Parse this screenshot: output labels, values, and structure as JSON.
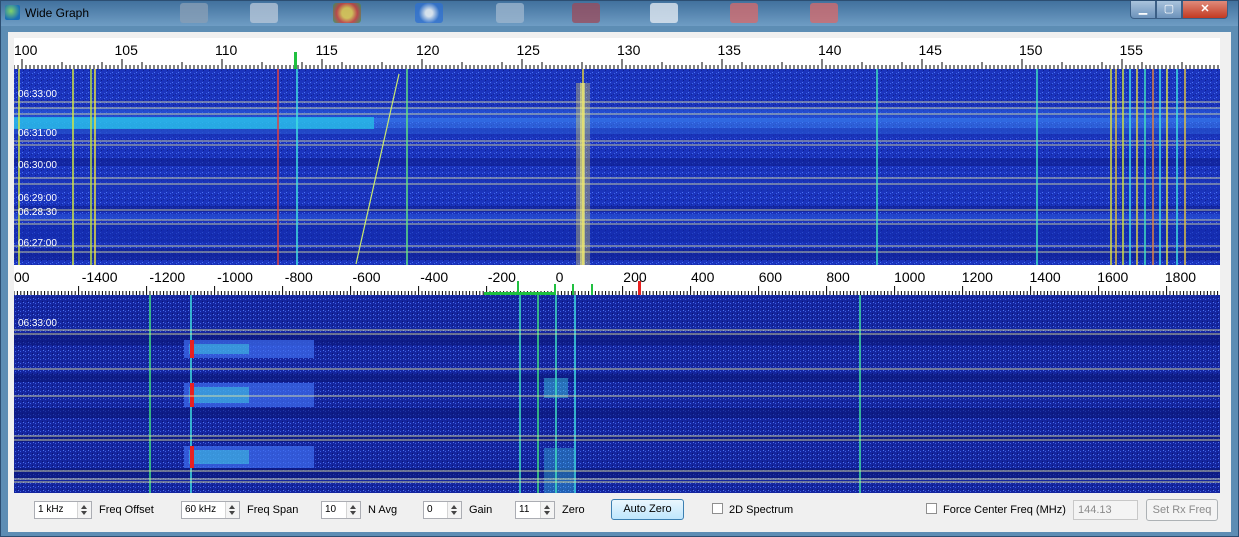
{
  "window": {
    "title": "Wide Graph",
    "min_symbol": "▁",
    "max_symbol": "▢",
    "close_symbol": "✕"
  },
  "colors": {
    "waterfall_bg": "#1a2fb4",
    "waterfall_dark": "#0c1c8a",
    "scale_bg": "#ffffff",
    "timestamp_line": "#e8e8a0",
    "signal_green": "#2ee84a",
    "signal_red": "#e8201c",
    "taskbar": "#4f7eab"
  },
  "top_scale": {
    "unit": "kHz offset (MHz scale)",
    "tick_labels": [
      "100",
      "105",
      "110",
      "115",
      "120",
      "125",
      "130",
      "135",
      "140",
      "145",
      "150",
      "155",
      "16"
    ]
  },
  "top_waterfall": {
    "timestamps": [
      "06:33:00",
      "06:31:00",
      "06:30:00",
      "06:29:00",
      "06:28:30",
      "06:27:00"
    ]
  },
  "bottom_scale": {
    "tick_labels": [
      "00",
      "-1400",
      "-1200",
      "-1000",
      "-800",
      "-600",
      "-400",
      "-200",
      "0",
      "200",
      "400",
      "600",
      "800",
      "1000",
      "1200",
      "1400",
      "1600",
      "1800"
    ]
  },
  "bottom_waterfall": {
    "timestamps": [
      "06:33:00"
    ]
  },
  "controls": {
    "bins_per_pixel": {
      "value": "1 kHz",
      "label": "Freq Offset"
    },
    "freq_span": {
      "value": "60 kHz",
      "label": "Freq Span"
    },
    "n_avg": {
      "value": "10",
      "label": "N Avg"
    },
    "gain": {
      "value": "0",
      "label": "Gain"
    },
    "zero": {
      "value": "11",
      "label": "Zero"
    },
    "auto_zero_label": "Auto Zero",
    "spectrum_2d": {
      "label": "2D Spectrum",
      "checked": false
    },
    "force_center": {
      "label": "Force Center Freq (MHz)",
      "checked": false
    },
    "center_freq_value": "144.13",
    "set_rx_freq_label": "Set Rx Freq"
  }
}
